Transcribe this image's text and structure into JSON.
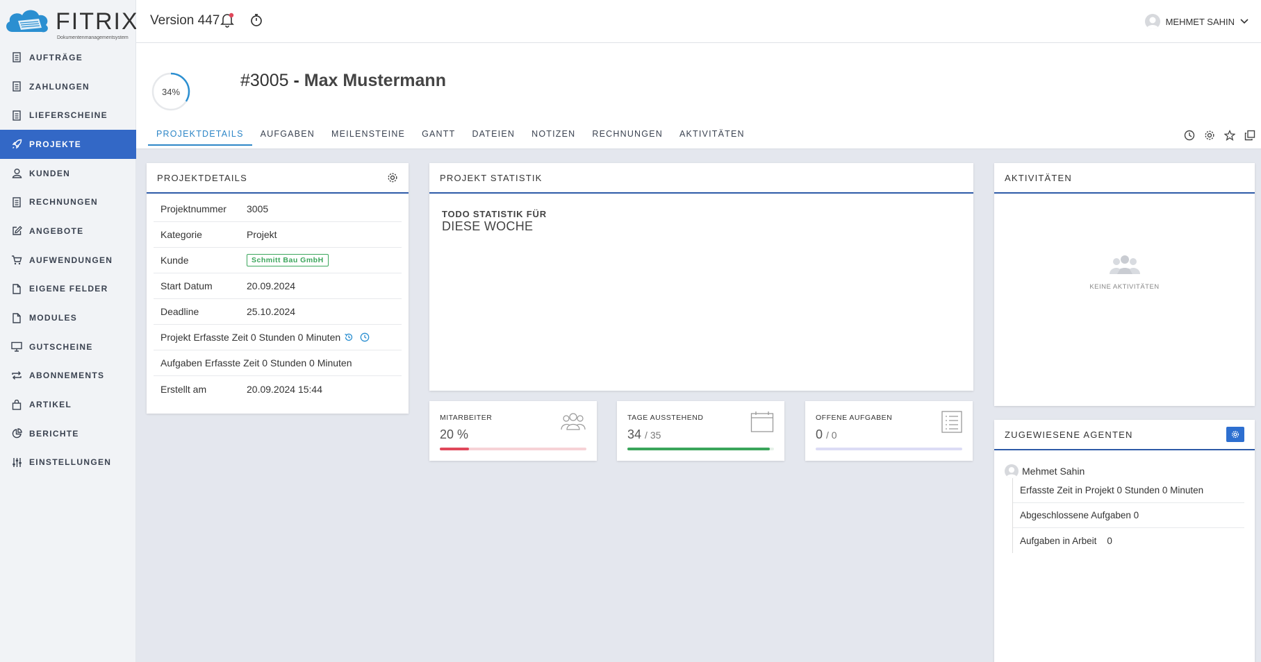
{
  "brand": {
    "name": "FITRIX",
    "subtitle": "Dokumentenmanagementsystem"
  },
  "header": {
    "version": "Version 447",
    "user": "MEHMET SAHIN"
  },
  "sidebar": {
    "items": [
      {
        "label": "AUFTRÄGE",
        "icon": "document-icon"
      },
      {
        "label": "ZAHLUNGEN",
        "icon": "document-icon"
      },
      {
        "label": "LIEFERSCHEINE",
        "icon": "document-icon"
      },
      {
        "label": "PROJEKTE",
        "icon": "rocket-icon",
        "active": true
      },
      {
        "label": "KUNDEN",
        "icon": "user-icon"
      },
      {
        "label": "RECHNUNGEN",
        "icon": "document-icon"
      },
      {
        "label": "ANGEBOTE",
        "icon": "edit-icon"
      },
      {
        "label": "AUFWENDUNGEN",
        "icon": "cart-icon"
      },
      {
        "label": "EIGENE FELDER",
        "icon": "file-icon"
      },
      {
        "label": "MODULES",
        "icon": "file-icon"
      },
      {
        "label": "GUTSCHEINE",
        "icon": "monitor-icon"
      },
      {
        "label": "ABONNEMENTS",
        "icon": "repeat-icon"
      },
      {
        "label": "ARTIKEL",
        "icon": "bag-icon"
      },
      {
        "label": "BERICHTE",
        "icon": "pie-chart-icon"
      },
      {
        "label": "EINSTELLUNGEN",
        "icon": "sliders-icon"
      }
    ]
  },
  "project": {
    "progress_label": "34%",
    "progress": 0.34,
    "number": "#3005",
    "separator": "-",
    "name": "Max Mustermann",
    "tabs": [
      "PROJEKTDETAILS",
      "AUFGABEN",
      "MEILENSTEINE",
      "GANTT",
      "DATEIEN",
      "NOTIZEN",
      "RECHNUNGEN",
      "AKTIVITÄTEN"
    ]
  },
  "details": {
    "title": "PROJEKTDETAILS",
    "rows": {
      "nummer": {
        "label": "Projektnummer",
        "value": "3005"
      },
      "kategorie": {
        "label": "Kategorie",
        "value": "Projekt"
      },
      "kunde": {
        "label": "Kunde",
        "value": "Schmitt Bau GmbH"
      },
      "start": {
        "label": "Start Datum",
        "value": "20.09.2024"
      },
      "deadline": {
        "label": "Deadline",
        "value": "25.10.2024"
      },
      "projekt_zeit": {
        "label": "Projekt Erfasste Zeit 0 Stunden 0 Minuten"
      },
      "aufgaben_zeit": {
        "label": "Aufgaben Erfasste Zeit 0 Stunden 0 Minuten"
      },
      "erstellt": {
        "label": "Erstellt am",
        "value": "20.09.2024 15:44"
      }
    }
  },
  "statistik": {
    "title": "PROJEKT STATISTIK",
    "line1": "TODO STATISTIK FÜR",
    "line2": "DIESE WOCHE"
  },
  "kpis": {
    "mitarbeiter": {
      "title": "MITARBEITER",
      "value": "20 %",
      "progress": 0.2,
      "color": "#e0475a",
      "track": "#f6d2d6"
    },
    "tage": {
      "title": "TAGE AUSSTEHEND",
      "value": "34",
      "total": "/ 35",
      "progress": 0.97,
      "color": "#3aa55b",
      "track": "#e6f2e9"
    },
    "aufgaben": {
      "title": "OFFENE AUFGABEN",
      "value": "0",
      "total": "/ 0",
      "progress": 0,
      "color": "#6c6fd8",
      "track": "#dcdcf5"
    }
  },
  "aktivitaeten": {
    "title": "AKTIVITÄTEN",
    "empty": "KEINE AKTIVITÄTEN"
  },
  "agenten": {
    "title": "ZUGEWIESENE AGENTEN",
    "name": "Mehmet Sahin",
    "rows": [
      "Erfasste Zeit in Projekt 0 Stunden 0 Minuten",
      "Abgeschlossene Aufgaben 0",
      "Aufgaben in Arbeit    0"
    ]
  },
  "colors": {
    "accent": "#3368c6",
    "tab_active": "#2d86c7",
    "success": "#3aa55b"
  }
}
